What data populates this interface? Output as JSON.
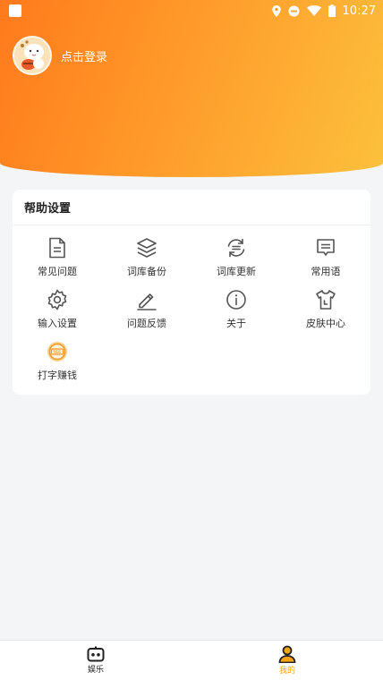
{
  "status_bar": {
    "time": "10:27"
  },
  "profile": {
    "login_text": "点击登录"
  },
  "help_settings": {
    "title": "帮助设置",
    "items": [
      {
        "label": "常见问题",
        "icon": "document-icon"
      },
      {
        "label": "词库备份",
        "icon": "layers-icon"
      },
      {
        "label": "词库更新",
        "icon": "refresh-icon"
      },
      {
        "label": "常用语",
        "icon": "message-icon"
      },
      {
        "label": "输入设置",
        "icon": "gear-icon"
      },
      {
        "label": "问题反馈",
        "icon": "edit-icon"
      },
      {
        "label": "关于",
        "icon": "info-icon"
      },
      {
        "label": "皮肤中心",
        "icon": "shirt-icon"
      },
      {
        "label": "打字赚钱",
        "icon": "coin-icon"
      }
    ]
  },
  "tab_bar": {
    "tabs": [
      {
        "label": "娱乐",
        "icon": "robot-icon",
        "active": false
      },
      {
        "label": "我的",
        "icon": "user-icon",
        "active": true
      }
    ]
  },
  "colors": {
    "header_start": "#ff7a1c",
    "header_end": "#fcc13c",
    "active_tab": "#f6a313",
    "icon": "#555555"
  }
}
